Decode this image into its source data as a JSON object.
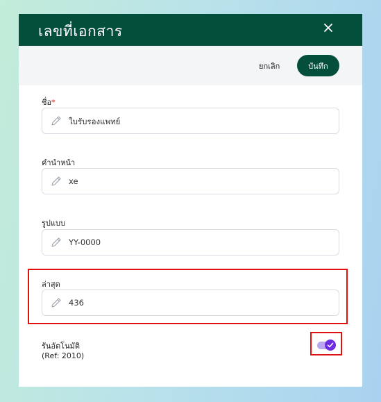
{
  "dialog": {
    "title": "เลขที่เอกสาร",
    "close_icon": "close-icon"
  },
  "toolbar": {
    "cancel_label": "ยกเลิก",
    "save_label": "บันทึก"
  },
  "fields": {
    "name": {
      "label": "ชื่อ",
      "required_mark": "*",
      "value": "ใบรับรองแพทย์",
      "icon": "pencil-icon"
    },
    "prefix": {
      "label": "คำนำหน้า",
      "value": "xe",
      "icon": "pencil-icon"
    },
    "format": {
      "label": "รูปแบบ",
      "value": "YY-0000",
      "icon": "pencil-icon"
    },
    "latest": {
      "label": "ล่าสุด",
      "value": "436",
      "icon": "pencil-icon"
    }
  },
  "auto_run": {
    "label": "รันอัตโนมัติ",
    "ref": "(Ref: 2010)",
    "enabled": true,
    "icon": "check-icon"
  },
  "colors": {
    "header_bg": "#044e3c",
    "save_button_bg": "#044e3c",
    "highlight": "#e01010",
    "toggle_on": "#6d2ce0",
    "required": "#e02424"
  }
}
